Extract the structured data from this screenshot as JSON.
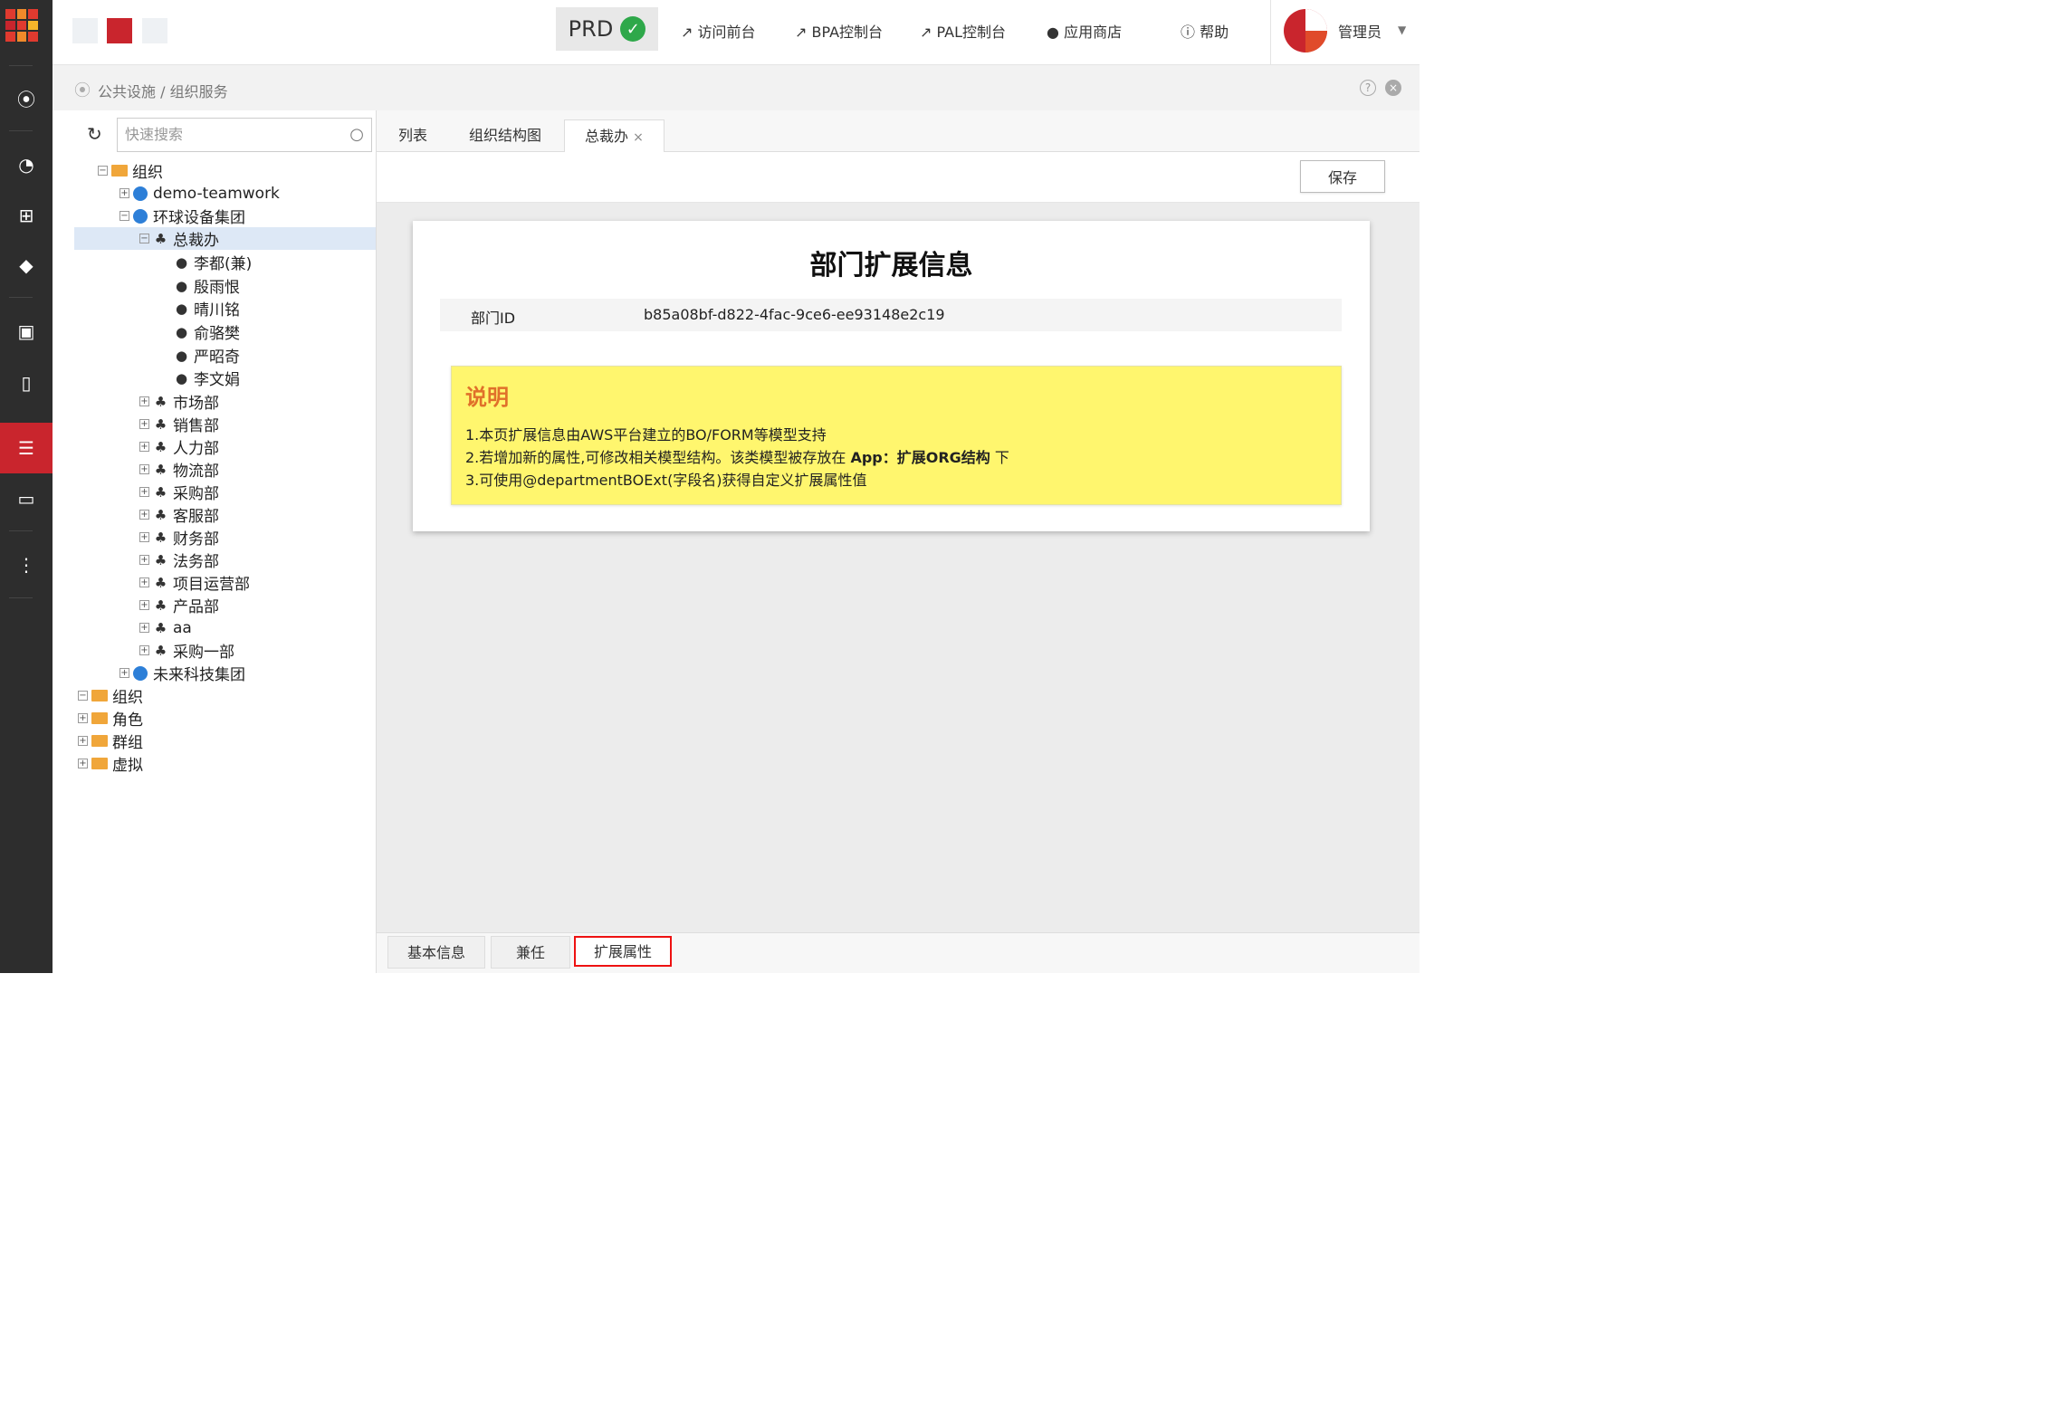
{
  "topbar": {
    "env": "PRD",
    "links": [
      "访问前台",
      "BPA控制台",
      "PAL控制台"
    ],
    "app_store": "应用商店",
    "help": "帮助",
    "user": "管理员"
  },
  "breadcrumb": {
    "path": "公共设施 / 组织服务"
  },
  "tree": {
    "search_placeholder": "快速搜索",
    "nodes": {
      "root": "组织",
      "n1": "demo-teamwork",
      "n2": "环球设备集团",
      "n3": "总裁办",
      "u1": "李都(兼)",
      "u2": "殷雨恨",
      "u3": "晴川铭",
      "u4": "俞骆樊",
      "u5": "严昭奇",
      "u6": "李文娟",
      "d1": "市场部",
      "d2": "销售部",
      "d3": "人力部",
      "d4": "物流部",
      "d5": "采购部",
      "d6": "客服部",
      "d7": "财务部",
      "d8": "法务部",
      "d9": "项目运营部",
      "d10": "产品部",
      "d11": "aa",
      "d12": "采购一部",
      "n4": "未来科技集团",
      "r1": "组织",
      "r2": "角色",
      "r3": "群组",
      "r4": "虚拟"
    }
  },
  "main": {
    "tabs": [
      "列表",
      "组织结构图",
      "总裁办"
    ],
    "save": "保存",
    "card": {
      "title": "部门扩展信息",
      "id_label": "部门ID",
      "id_value": "b85a08bf-d822-4fac-9ce6-ee93148e2c19",
      "note_title": "说明",
      "note_line1": "1.本页扩展信息由AWS平台建立的BO/FORM等模型支持",
      "note_line2_pre": "2.若增加新的属性,可修改相关模型结构。该类模型被存放在 ",
      "note_line2_bold": "App：扩展ORG结构",
      "note_line2_post": " 下",
      "note_line3": "3.可使用@departmentBOExt(字段名)获得自定义扩展属性值"
    },
    "bottom_tabs": [
      "基本信息",
      "兼任",
      "扩展属性"
    ]
  },
  "colors": {
    "accent": "#c9252d",
    "note": "#fff66e",
    "ok": "#2ea84a"
  }
}
